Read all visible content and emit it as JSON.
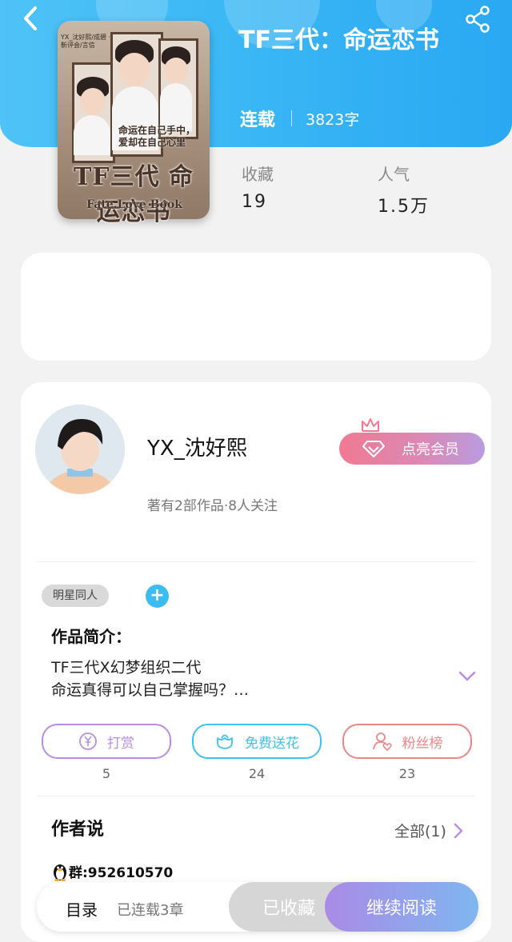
{
  "header": {
    "book_title": "TF三代：命运恋书",
    "status": "连载",
    "word_count": "3823字",
    "accent_color": "#3bb5f5"
  },
  "cover": {
    "title": "TF三代 命运恋书",
    "subtitle": "Fate.Love Book",
    "slogan_line1": "命运在自己手中，",
    "slogan_line2": "爱却在自己心里",
    "credits": "YX_沈好熙/成碧 · 靳评会/言信"
  },
  "stats": {
    "favorites_label": "收藏",
    "favorites_value": "19",
    "popularity_label": "人气",
    "popularity_value": "1.5万"
  },
  "author": {
    "name": "YX_沈好熙",
    "meta": "著有2部作品·8人关注",
    "vip_label": "点亮会员"
  },
  "tags": {
    "items": [
      "明星同人"
    ],
    "add_symbol": "+"
  },
  "intro": {
    "title": "作品简介：",
    "line1": "TF三代X幻梦组织二代",
    "line2": "命运真得可以自己掌握吗？…"
  },
  "actions": {
    "reward_label": "打赏",
    "reward_count": "5",
    "flower_label": "免费送花",
    "flower_count": "24",
    "fans_label": "粉丝榜",
    "fans_count": "23",
    "reward_color": "#b98ee0",
    "flower_color": "#3fc1e8",
    "fans_color": "#e98787"
  },
  "author_says": {
    "title": "作者说",
    "all_label": "全部(1)",
    "qq_group": "群:952610570"
  },
  "bottom_bar": {
    "catalog_label": "目录",
    "chapters_label": "已连载3章",
    "favorited_label": "已收藏",
    "read_label": "继续阅读"
  }
}
